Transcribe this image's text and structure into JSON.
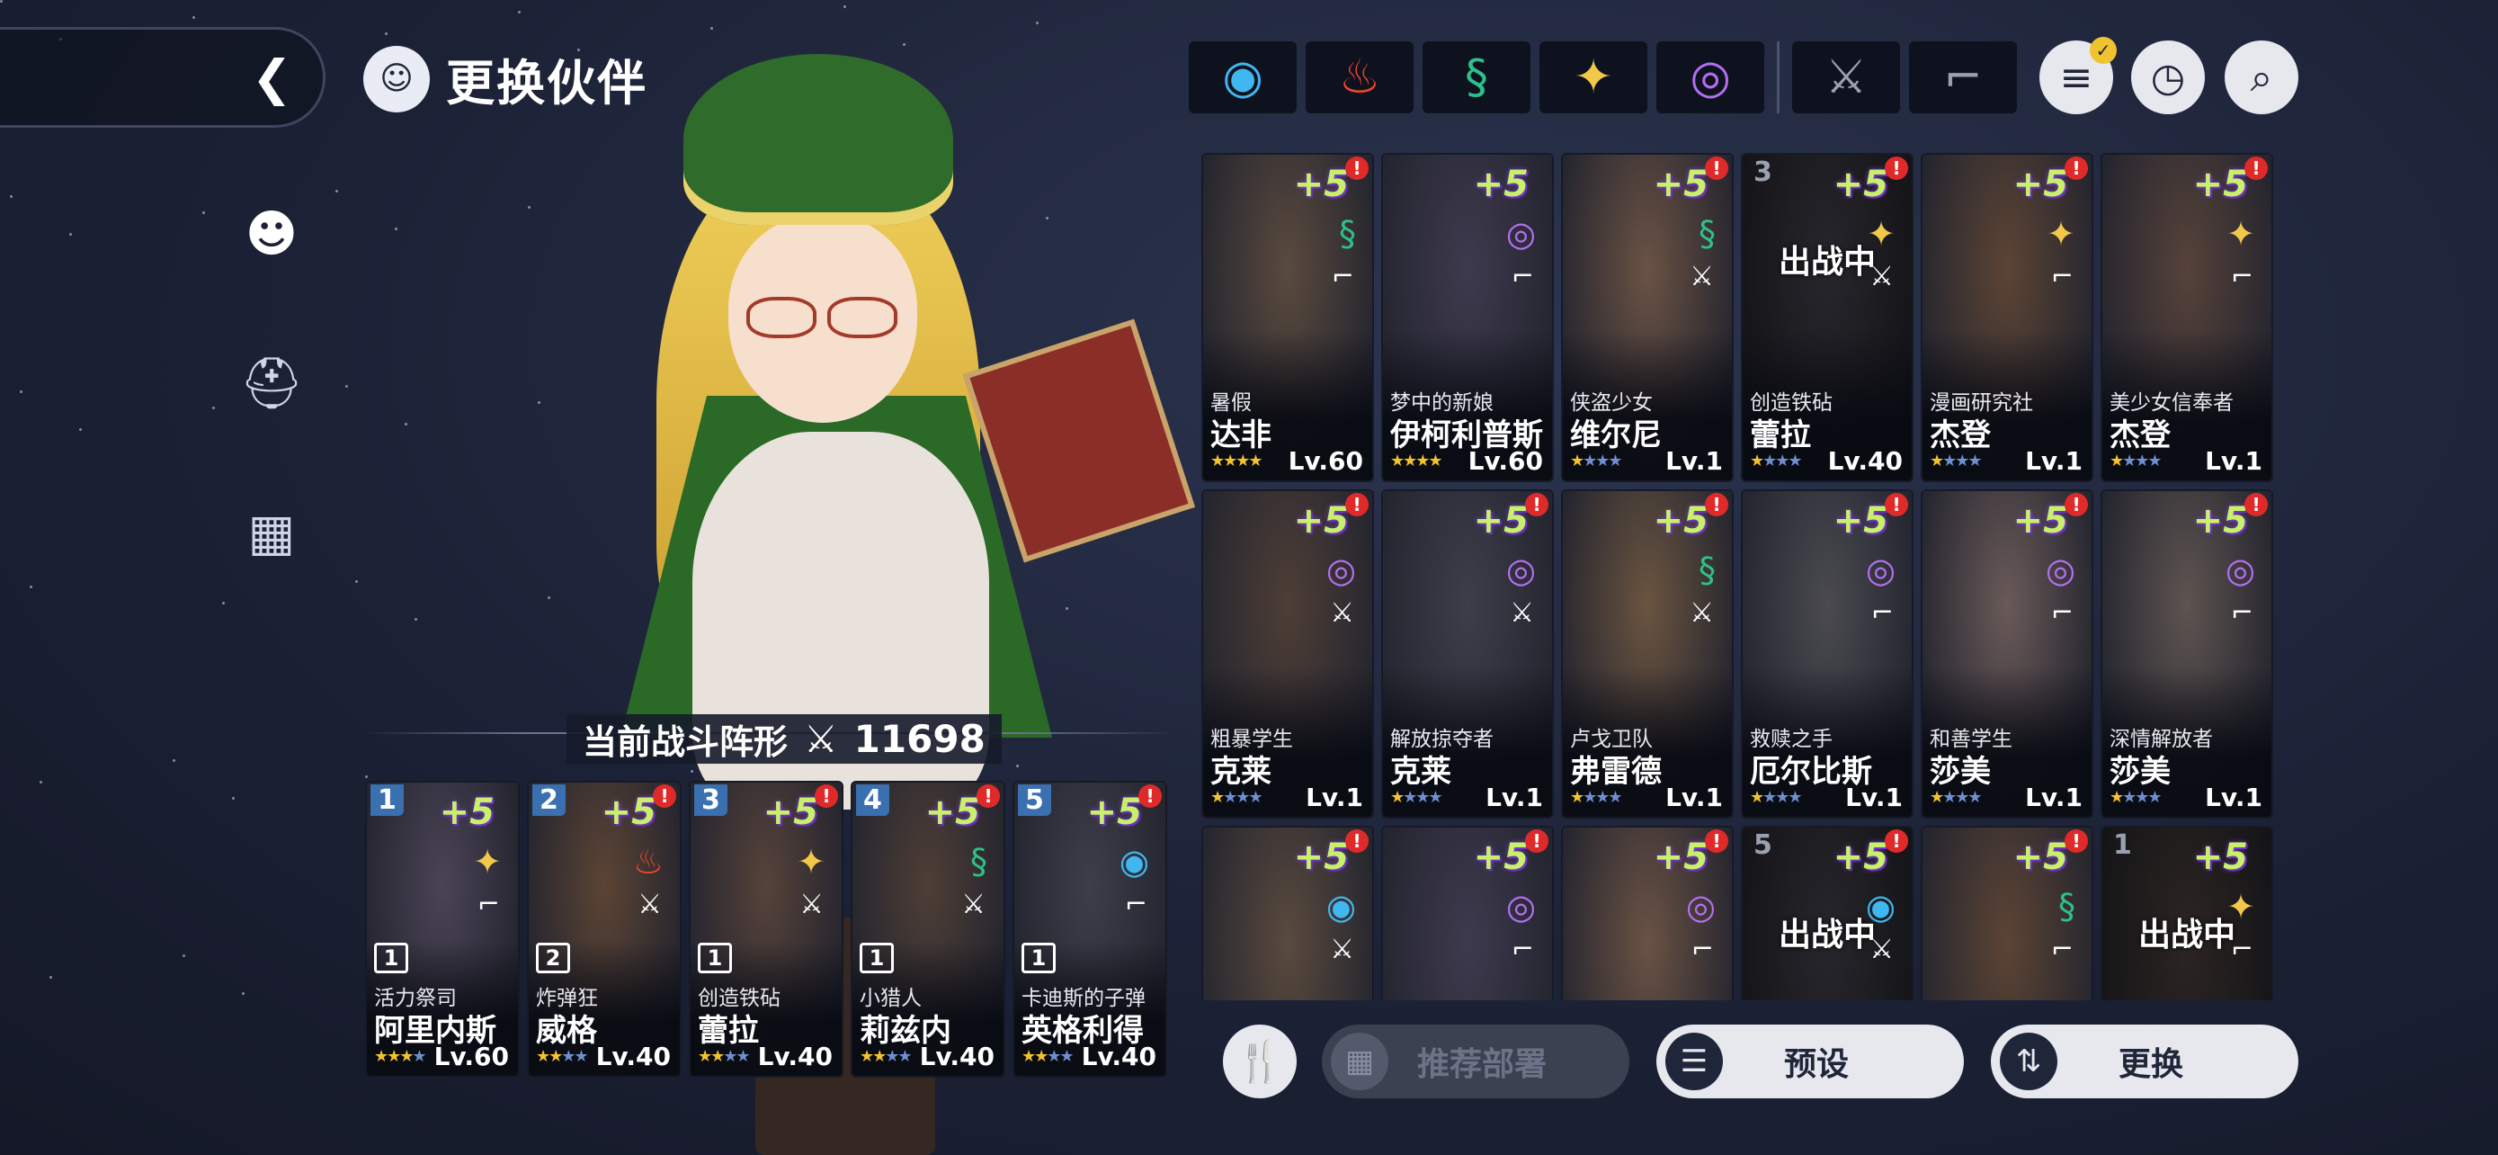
{
  "header": {
    "title": "更换伙伴",
    "back_icon": "chevron-left-icon"
  },
  "side_nav": [
    {
      "icon": "character-head-icon",
      "active": true
    },
    {
      "icon": "spartan-helmet-icon",
      "active": false
    },
    {
      "icon": "grid-formation-icon",
      "active": false
    }
  ],
  "formation": {
    "label": "当前战斗阵形",
    "power": "11698",
    "members": [
      {
        "slot": "1",
        "plus": "+5",
        "badge": "1",
        "title": "活力祭司",
        "name": "阿里内斯",
        "stars": 3,
        "level": "Lv.60",
        "element": "light",
        "class": "gun",
        "alert": false
      },
      {
        "slot": "2",
        "plus": "+5",
        "badge": "2",
        "title": "炸弹狂",
        "name": "威格",
        "stars": 2,
        "level": "Lv.40",
        "element": "fire",
        "class": "sword",
        "alert": true
      },
      {
        "slot": "3",
        "plus": "+5",
        "badge": "1",
        "title": "创造铁砧",
        "name": "蕾拉",
        "stars": 2,
        "level": "Lv.40",
        "element": "light",
        "class": "sword",
        "alert": true
      },
      {
        "slot": "4",
        "plus": "+5",
        "badge": "1",
        "title": "小猎人",
        "name": "莉兹内",
        "stars": 2,
        "level": "Lv.40",
        "element": "earth",
        "class": "sword",
        "alert": true
      },
      {
        "slot": "5",
        "plus": "+5",
        "badge": "1",
        "title": "卡迪斯的子弹",
        "name": "英格利得",
        "stars": 2,
        "level": "Lv.40",
        "element": "water",
        "class": "gun",
        "alert": true
      }
    ]
  },
  "filters": {
    "elements": [
      {
        "name": "water",
        "icon": "water-element-icon",
        "glyph": "◉",
        "color": "#3fb7f0"
      },
      {
        "name": "fire",
        "icon": "fire-element-icon",
        "glyph": "♨",
        "color": "#f0452e"
      },
      {
        "name": "earth",
        "icon": "earth-element-icon",
        "glyph": "§",
        "color": "#2ec08a"
      },
      {
        "name": "light",
        "icon": "light-element-icon",
        "glyph": "✦",
        "color": "#f2c84a"
      },
      {
        "name": "dark",
        "icon": "dark-element-icon",
        "glyph": "◎",
        "color": "#b46ef0"
      }
    ],
    "classes": [
      {
        "name": "sword",
        "icon": "sword-class-icon",
        "glyph": "⚔",
        "color": "#9aa0b0"
      },
      {
        "name": "gun",
        "icon": "gun-class-icon",
        "glyph": "⌐",
        "color": "#9aa0b0"
      }
    ],
    "tools": [
      {
        "icon": "filter-list-icon",
        "glyph": "≡",
        "checked": true
      },
      {
        "icon": "stopwatch-icon",
        "glyph": "◷",
        "checked": false
      },
      {
        "icon": "search-icon",
        "glyph": "⌕",
        "checked": false
      }
    ]
  },
  "roster": [
    {
      "title": "暑假",
      "name": "达非",
      "stars": 4,
      "level": "Lv.60",
      "element": "earth",
      "class": "gun",
      "plus": "+5",
      "alert": true,
      "deployed": false,
      "slot_num": ""
    },
    {
      "title": "梦中的新娘",
      "name": "伊柯利普斯",
      "stars": 4,
      "level": "Lv.60",
      "element": "dark",
      "class": "gun",
      "plus": "+5",
      "alert": false,
      "deployed": false,
      "slot_num": ""
    },
    {
      "title": "侠盗少女",
      "name": "维尔尼",
      "stars": 1,
      "level": "Lv.1",
      "element": "earth",
      "class": "sword",
      "plus": "+5",
      "alert": true,
      "deployed": false,
      "slot_num": ""
    },
    {
      "title": "创造铁砧",
      "name": "蕾拉",
      "stars": 1,
      "level": "Lv.40",
      "element": "light",
      "class": "sword",
      "plus": "+5",
      "alert": true,
      "deployed": true,
      "deploy_text": "出战中",
      "slot_num": "3"
    },
    {
      "title": "漫画研究社",
      "name": "杰登",
      "stars": 1,
      "level": "Lv.1",
      "element": "light",
      "class": "gun",
      "plus": "+5",
      "alert": true,
      "deployed": false,
      "slot_num": ""
    },
    {
      "title": "美少女信奉者",
      "name": "杰登",
      "stars": 1,
      "level": "Lv.1",
      "element": "light",
      "class": "gun",
      "plus": "+5",
      "alert": true,
      "deployed": false,
      "slot_num": ""
    },
    {
      "title": "粗暴学生",
      "name": "克莱",
      "stars": 1,
      "level": "Lv.1",
      "element": "dark",
      "class": "sword",
      "plus": "+5",
      "alert": true,
      "deployed": false,
      "slot_num": ""
    },
    {
      "title": "解放掠夺者",
      "name": "克莱",
      "stars": 1,
      "level": "Lv.1",
      "element": "dark",
      "class": "sword",
      "plus": "+5",
      "alert": true,
      "deployed": false,
      "slot_num": ""
    },
    {
      "title": "卢戈卫队",
      "name": "弗雷德",
      "stars": 1,
      "level": "Lv.1",
      "element": "earth",
      "class": "sword",
      "plus": "+5",
      "alert": true,
      "deployed": false,
      "slot_num": ""
    },
    {
      "title": "救赎之手",
      "name": "厄尔比斯",
      "stars": 1,
      "level": "Lv.1",
      "element": "dark",
      "class": "gun",
      "plus": "+5",
      "alert": true,
      "deployed": false,
      "slot_num": ""
    },
    {
      "title": "和善学生",
      "name": "莎美",
      "stars": 1,
      "level": "Lv.1",
      "element": "dark",
      "class": "gun",
      "plus": "+5",
      "alert": true,
      "deployed": false,
      "slot_num": ""
    },
    {
      "title": "深情解放者",
      "name": "莎美",
      "stars": 1,
      "level": "Lv.1",
      "element": "dark",
      "class": "gun",
      "plus": "+5",
      "alert": true,
      "deployed": false,
      "slot_num": ""
    },
    {
      "title": "",
      "name": "",
      "stars": 0,
      "level": "",
      "element": "water",
      "class": "sword",
      "plus": "+5",
      "alert": true,
      "deployed": false,
      "slot_num": ""
    },
    {
      "title": "",
      "name": "",
      "stars": 0,
      "level": "",
      "element": "dark",
      "class": "gun",
      "plus": "+5",
      "alert": true,
      "deployed": false,
      "slot_num": ""
    },
    {
      "title": "",
      "name": "",
      "stars": 0,
      "level": "",
      "element": "dark",
      "class": "gun",
      "plus": "+5",
      "alert": true,
      "deployed": false,
      "slot_num": ""
    },
    {
      "title": "",
      "name": "",
      "stars": 0,
      "level": "",
      "element": "water",
      "class": "sword",
      "plus": "+5",
      "alert": true,
      "deployed": true,
      "deploy_text": "出战中",
      "slot_num": "5"
    },
    {
      "title": "",
      "name": "",
      "stars": 0,
      "level": "",
      "element": "earth",
      "class": "gun",
      "plus": "+5",
      "alert": true,
      "deployed": false,
      "slot_num": ""
    },
    {
      "title": "",
      "name": "",
      "stars": 0,
      "level": "",
      "element": "light",
      "class": "gun",
      "plus": "+5",
      "alert": false,
      "deployed": true,
      "deploy_text": "出战中",
      "slot_num": "1"
    }
  ],
  "actions": {
    "food_icon": "fork-knife-icon",
    "recommend_label": "推荐部署",
    "preset_label": "预设",
    "swap_label": "更换"
  }
}
